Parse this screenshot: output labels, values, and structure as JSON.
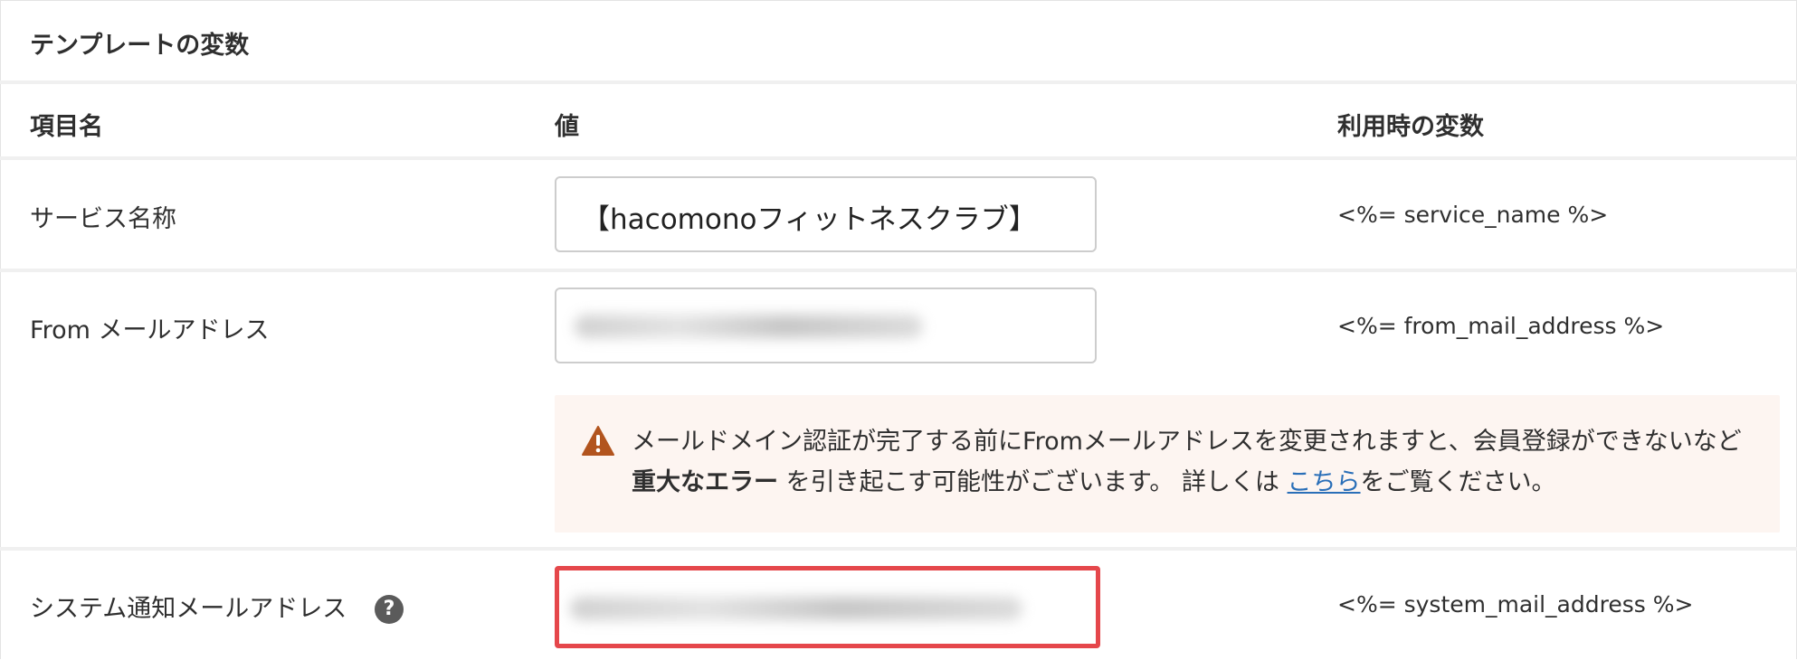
{
  "section": {
    "title": "テンプレートの変数"
  },
  "columns": {
    "item": "項目名",
    "value": "値",
    "variable": "利用時の変数"
  },
  "rows": [
    {
      "label": "サービス名称",
      "value": "【hacomonoフィットネスクラブ】",
      "variable": "<%= service_name %>"
    },
    {
      "label": "From メールアドレス",
      "value": "",
      "variable": "<%= from_mail_address %>"
    },
    {
      "label": "システム通知メールアドレス",
      "value": "",
      "variable": "<%= system_mail_address %>"
    }
  ],
  "warning": {
    "part1": "メールドメイン認証が完了する前にFromメールアドレスを変更されますと、会員登録ができないなど",
    "bold": "重大なエラー",
    "part2": "を引き起こす可能性がございます。 詳しくは",
    "link": "こちら",
    "part3": "をご覧ください。"
  },
  "icons": {
    "warning": "warning-triangle-icon",
    "help": "question-circle-icon"
  },
  "colors": {
    "warning_bg": "#fdf5f1",
    "warning_icon": "#b2541e",
    "link": "#2a6fb8",
    "highlight": "#e5474b"
  }
}
